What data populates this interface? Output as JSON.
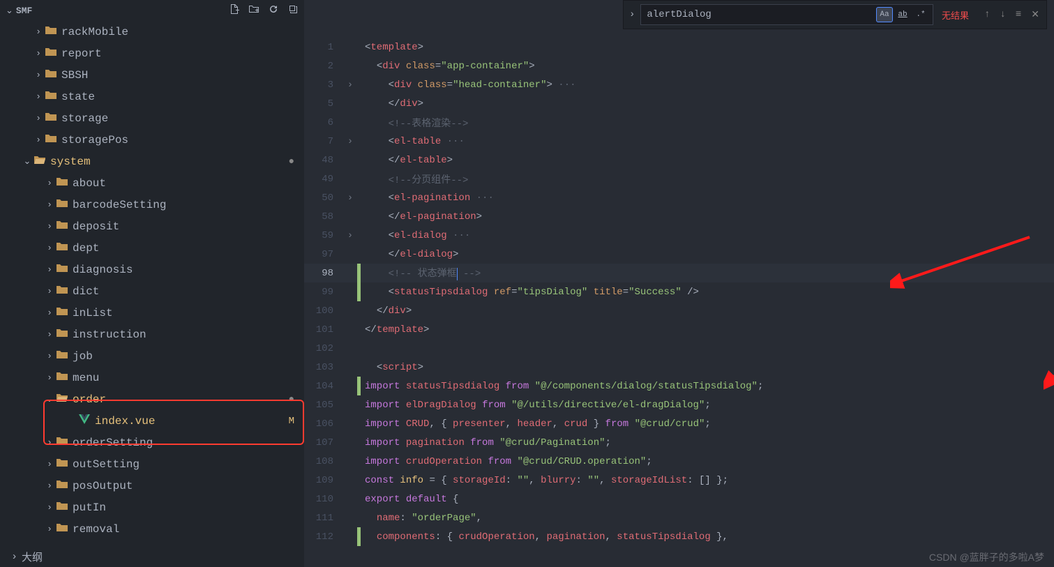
{
  "sidebar": {
    "title": "SMF",
    "outline": "大纲",
    "tree": [
      {
        "indent": 3,
        "chev": ">",
        "type": "folder",
        "label": "rackMobile"
      },
      {
        "indent": 3,
        "chev": ">",
        "type": "folder",
        "label": "report"
      },
      {
        "indent": 3,
        "chev": ">",
        "type": "folder",
        "label": "SBSH"
      },
      {
        "indent": 3,
        "chev": ">",
        "type": "folder",
        "label": "state"
      },
      {
        "indent": 3,
        "chev": ">",
        "type": "folder",
        "label": "storage"
      },
      {
        "indent": 3,
        "chev": ">",
        "type": "folder",
        "label": "storagePos"
      },
      {
        "indent": 2,
        "chev": "v",
        "type": "folder-open",
        "label": "system",
        "highlighted": true,
        "dot": true
      },
      {
        "indent": 4,
        "chev": ">",
        "type": "folder",
        "label": "about"
      },
      {
        "indent": 4,
        "chev": ">",
        "type": "folder",
        "label": "barcodeSetting"
      },
      {
        "indent": 4,
        "chev": ">",
        "type": "folder",
        "label": "deposit"
      },
      {
        "indent": 4,
        "chev": ">",
        "type": "folder",
        "label": "dept"
      },
      {
        "indent": 4,
        "chev": ">",
        "type": "folder",
        "label": "diagnosis"
      },
      {
        "indent": 4,
        "chev": ">",
        "type": "folder",
        "label": "dict"
      },
      {
        "indent": 4,
        "chev": ">",
        "type": "folder",
        "label": "inList"
      },
      {
        "indent": 4,
        "chev": ">",
        "type": "folder",
        "label": "instruction"
      },
      {
        "indent": 4,
        "chev": ">",
        "type": "folder",
        "label": "job"
      },
      {
        "indent": 4,
        "chev": ">",
        "type": "folder",
        "label": "menu"
      },
      {
        "indent": 4,
        "chev": "v",
        "type": "folder-open",
        "label": "order",
        "highlighted": true,
        "dot": true,
        "boxed": true
      },
      {
        "indent": 6,
        "chev": "",
        "type": "vue",
        "label": "index.vue",
        "tag": "M",
        "boxed": true
      },
      {
        "indent": 4,
        "chev": ">",
        "type": "folder",
        "label": "orderSetting"
      },
      {
        "indent": 4,
        "chev": ">",
        "type": "folder",
        "label": "outSetting"
      },
      {
        "indent": 4,
        "chev": ">",
        "type": "folder",
        "label": "posOutput"
      },
      {
        "indent": 4,
        "chev": ">",
        "type": "folder",
        "label": "putIn"
      },
      {
        "indent": 4,
        "chev": ">",
        "type": "folder",
        "label": "removal"
      }
    ]
  },
  "search": {
    "value": "alertDialog",
    "result": "无结果",
    "opts": [
      "Aa",
      "ab",
      ".*"
    ]
  },
  "code": [
    {
      "n": 1,
      "t": "<span class='c-punc'>&lt;</span><span class='c-tag'>template</span><span class='c-punc'>&gt;</span>"
    },
    {
      "n": 2,
      "t": "  <span class='c-punc'>&lt;</span><span class='c-tag'>div</span> <span class='c-attr'>class</span><span class='c-punc'>=</span><span class='c-str'>\"app-container\"</span><span class='c-punc'>&gt;</span>"
    },
    {
      "n": 3,
      "fold": ">",
      "t": "    <span class='c-punc'>&lt;</span><span class='c-tag'>div</span> <span class='c-attr'>class</span><span class='c-punc'>=</span><span class='c-str'>\"head-container\"</span><span class='c-punc'>&gt;</span><span class='fold-dots'> ···</span>"
    },
    {
      "n": 5,
      "t": "    <span class='c-punc'>&lt;/</span><span class='c-tag'>div</span><span class='c-punc'>&gt;</span>"
    },
    {
      "n": 6,
      "t": "    <span class='c-cmt'>&lt;!--表格渲染--&gt;</span>"
    },
    {
      "n": 7,
      "fold": ">",
      "t": "    <span class='c-punc'>&lt;</span><span class='c-tag'>el-table</span><span class='fold-dots'> ···</span>"
    },
    {
      "n": 48,
      "t": "    <span class='c-punc'>&lt;/</span><span class='c-tag'>el-table</span><span class='c-punc'>&gt;</span>"
    },
    {
      "n": 49,
      "t": "    <span class='c-cmt'>&lt;!--分页组件--&gt;</span>"
    },
    {
      "n": 50,
      "fold": ">",
      "t": "    <span class='c-punc'>&lt;</span><span class='c-tag'>el-pagination</span><span class='fold-dots'> ···</span>"
    },
    {
      "n": 58,
      "t": "    <span class='c-punc'>&lt;/</span><span class='c-tag'>el-pagination</span><span class='c-punc'>&gt;</span>"
    },
    {
      "n": 59,
      "fold": ">",
      "t": "    <span class='c-punc'>&lt;</span><span class='c-tag'>el-dialog</span><span class='fold-dots'> ···</span>"
    },
    {
      "n": 97,
      "t": "    <span class='c-punc'>&lt;/</span><span class='c-tag'>el-dialog</span><span class='c-punc'>&gt;</span>"
    },
    {
      "n": 98,
      "bar": true,
      "current": true,
      "t": "    <span class='c-cmt'>&lt;!-- 状态弹框</span><span class='cursor'></span><span class='c-cmt'> --&gt;</span>"
    },
    {
      "n": 99,
      "bar": true,
      "t": "    <span class='c-punc'>&lt;</span><span class='c-tag'>statusTipsdialog</span> <span class='c-attr'>ref</span><span class='c-punc'>=</span><span class='c-str'>\"tipsDialog\"</span> <span class='c-attr'>title</span><span class='c-punc'>=</span><span class='c-str'>\"Success\"</span> <span class='c-punc'>/&gt;</span>"
    },
    {
      "n": 100,
      "t": "  <span class='c-punc'>&lt;/</span><span class='c-tag'>div</span><span class='c-punc'>&gt;</span>"
    },
    {
      "n": 101,
      "t": "<span class='c-punc'>&lt;/</span><span class='c-tag'>template</span><span class='c-punc'>&gt;</span>"
    },
    {
      "n": 102,
      "t": ""
    },
    {
      "n": 103,
      "t": "  <span class='c-punc'>&lt;</span><span class='c-tag'>script</span><span class='c-punc'>&gt;</span>"
    },
    {
      "n": 104,
      "bar": true,
      "t": "<span class='c-key'>import</span> <span class='c-var'>statusTipsdialog</span> <span class='c-key'>from</span> <span class='c-str'>\"@/components/dialog/statusTipsdialog\"</span><span class='c-punc'>;</span>"
    },
    {
      "n": 105,
      "t": "<span class='c-key'>import</span> <span class='c-var'>elDragDialog</span> <span class='c-key'>from</span> <span class='c-str'>\"@/utils/directive/el-dragDialog\"</span><span class='c-punc'>;</span>"
    },
    {
      "n": 106,
      "t": "<span class='c-key'>import</span> <span class='c-var'>CRUD</span><span class='c-punc'>, { </span><span class='c-var'>presenter</span><span class='c-punc'>, </span><span class='c-var'>header</span><span class='c-punc'>, </span><span class='c-var'>crud</span><span class='c-punc'> } </span><span class='c-key'>from</span> <span class='c-str'>\"@crud/crud\"</span><span class='c-punc'>;</span>"
    },
    {
      "n": 107,
      "t": "<span class='c-key'>import</span> <span class='c-var'>pagination</span> <span class='c-key'>from</span> <span class='c-str'>\"@crud/Pagination\"</span><span class='c-punc'>;</span>"
    },
    {
      "n": 108,
      "t": "<span class='c-key'>import</span> <span class='c-var'>crudOperation</span> <span class='c-key'>from</span> <span class='c-str'>\"@crud/CRUD.operation\"</span><span class='c-punc'>;</span>"
    },
    {
      "n": 109,
      "t": "<span class='c-key'>const</span> <span class='c-func'>info</span> <span class='c-punc'>= { </span><span class='c-var'>storageId</span><span class='c-punc'>: </span><span class='c-str'>\"\"</span><span class='c-punc'>, </span><span class='c-var'>blurry</span><span class='c-punc'>: </span><span class='c-str'>\"\"</span><span class='c-punc'>, </span><span class='c-var'>storageIdList</span><span class='c-punc'>: [] };</span>"
    },
    {
      "n": 110,
      "t": "<span class='c-key'>export</span> <span class='c-key'>default</span> <span class='c-punc'>{</span>"
    },
    {
      "n": 111,
      "t": "  <span class='c-var'>name</span><span class='c-punc'>: </span><span class='c-str'>\"orderPage\"</span><span class='c-punc'>,</span>"
    },
    {
      "n": 112,
      "bar": true,
      "t": "  <span class='c-var'>components</span><span class='c-punc'>: { </span><span class='c-var'>crudOperation</span><span class='c-punc'>, </span><span class='c-var'>pagination</span><span class='c-punc'>, </span><span class='c-var'>statusTipsdialog</span><span class='c-punc'> },</span>"
    }
  ],
  "watermark": "CSDN @蓝胖子的多啦A梦"
}
